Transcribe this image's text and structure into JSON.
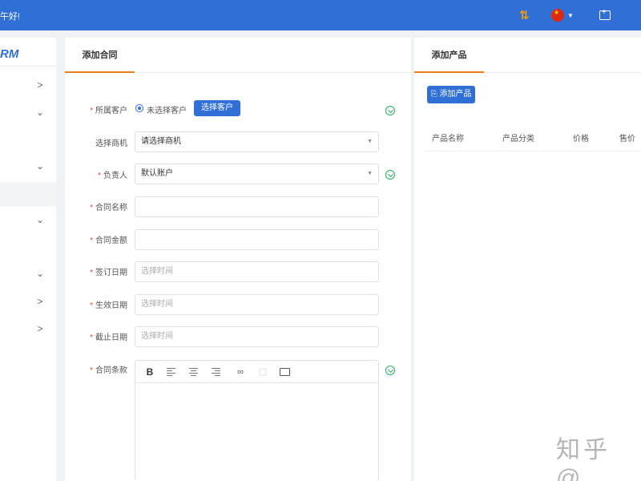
{
  "header": {
    "greeting": "午好!",
    "icons": [
      "refresh-icon",
      "china-flag-icon",
      "chevron-down-icon",
      "export-icon"
    ]
  },
  "sidebar": {
    "logo": "RM",
    "icons": [
      "chevron-right-icon",
      "chevron-down-icon",
      "chevron-down-icon",
      "chevron-down-icon",
      "chevron-down-icon",
      "chevron-right-icon",
      "chevron-right-icon"
    ]
  },
  "contract_form": {
    "tab_label": "添加合同",
    "customer": {
      "label": "所属客户",
      "radio_text": "未选择客户",
      "button": "选择客户"
    },
    "opportunity": {
      "label": "选择商机",
      "value": "请选择商机"
    },
    "owner": {
      "label": "负责人",
      "value": "默认账户"
    },
    "name": {
      "label": "合同名称",
      "value": ""
    },
    "amount": {
      "label": "合同金额",
      "value": ""
    },
    "sign_date": {
      "label": "签订日期",
      "placeholder": "选择时间"
    },
    "effective_date": {
      "label": "生效日期",
      "placeholder": "选择时间"
    },
    "end_date": {
      "label": "截止日期",
      "placeholder": "选择时间"
    },
    "terms": {
      "label": "合同条款",
      "toolbar": [
        "B"
      ]
    },
    "required_mark": "*"
  },
  "product_panel": {
    "tab_label": "添加产品",
    "add_button": "添加产品",
    "columns": [
      "产品名称",
      "产品分类",
      "价格",
      "售价"
    ]
  },
  "watermark": "知乎 @",
  "colors": {
    "brand": "#2f6fd6",
    "tab_accent": "#e67e22",
    "required": "#e74c3c",
    "info": "#27ae60"
  }
}
